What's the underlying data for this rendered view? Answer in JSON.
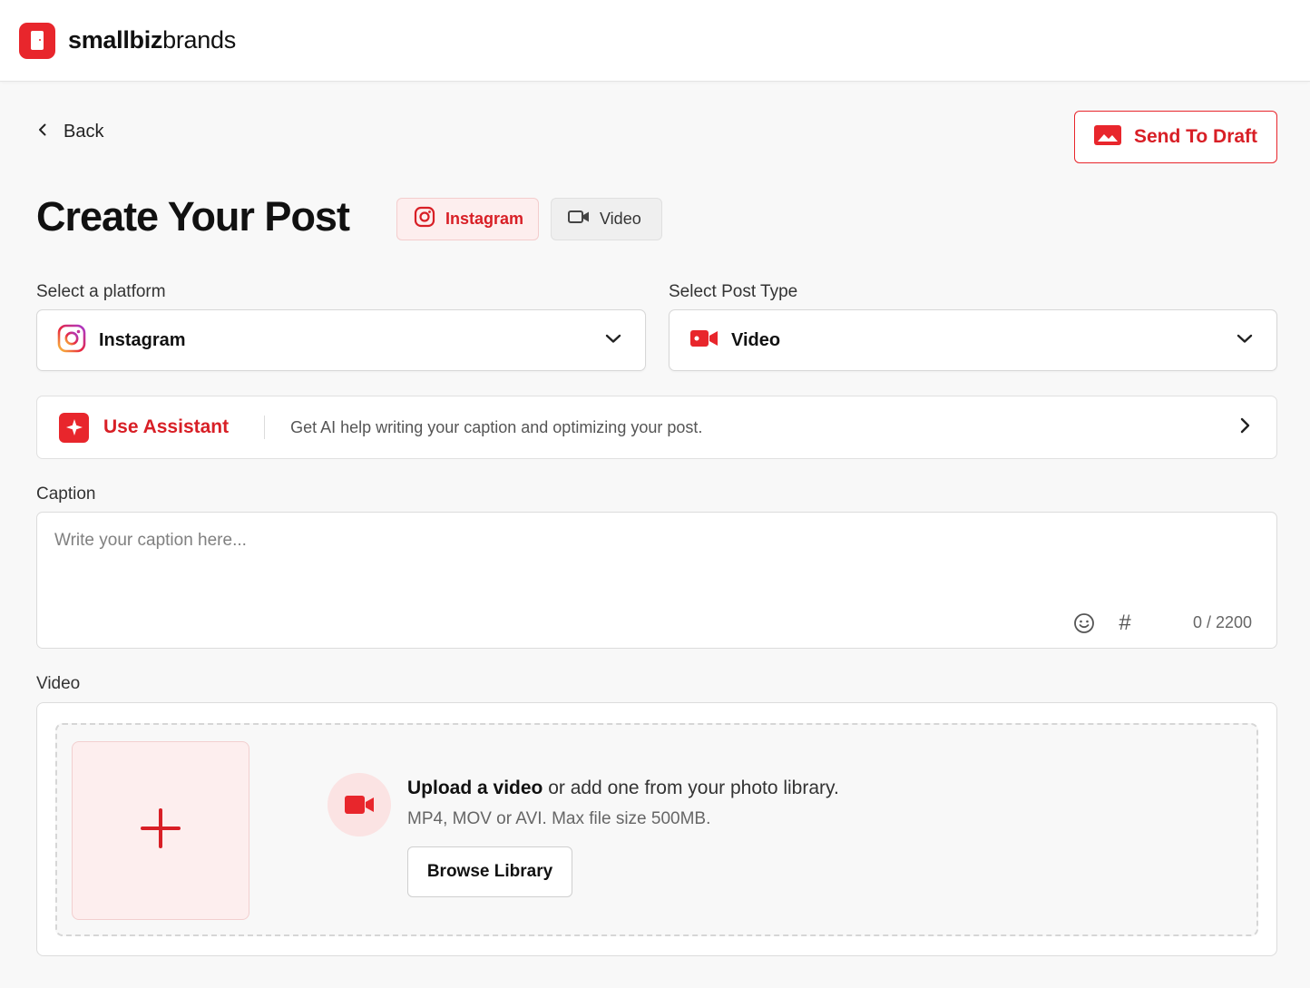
{
  "brand": {
    "name_bold": "smallbiz",
    "name_light": "brands",
    "color": "#e8262c"
  },
  "nav": {
    "back_label": "Back"
  },
  "actions": {
    "send_to_draft_label": "Send To Draft"
  },
  "page": {
    "title": "Create Your Post"
  },
  "chips": [
    {
      "label": "Instagram",
      "icon": "instagram-icon"
    },
    {
      "label": "Video",
      "icon": "video-camera-icon"
    }
  ],
  "platform_select": {
    "label": "Select a platform",
    "value": "Instagram",
    "icon": "instagram-icon"
  },
  "post_type_select": {
    "label": "Select Post Type",
    "value": "Video",
    "icon": "video-camera-icon"
  },
  "assistant": {
    "label": "Use Assistant",
    "description": "Get AI help writing your caption and optimizing your post."
  },
  "caption": {
    "label": "Caption",
    "placeholder": "Write your caption here...",
    "value": "",
    "hashtag_symbol": "#",
    "counter": "0 / 2200"
  },
  "video": {
    "label": "Video",
    "upload_title_bold": "Upload a video",
    "upload_title_rest": " or add one from your photo library.",
    "upload_subtitle": "MP4, MOV or AVI. Max file size 500MB.",
    "browse_label": "Browse Library"
  },
  "colors": {
    "accent": "#e8262c",
    "accent_text": "#d81f26",
    "accent_soft": "#fdeeee"
  }
}
